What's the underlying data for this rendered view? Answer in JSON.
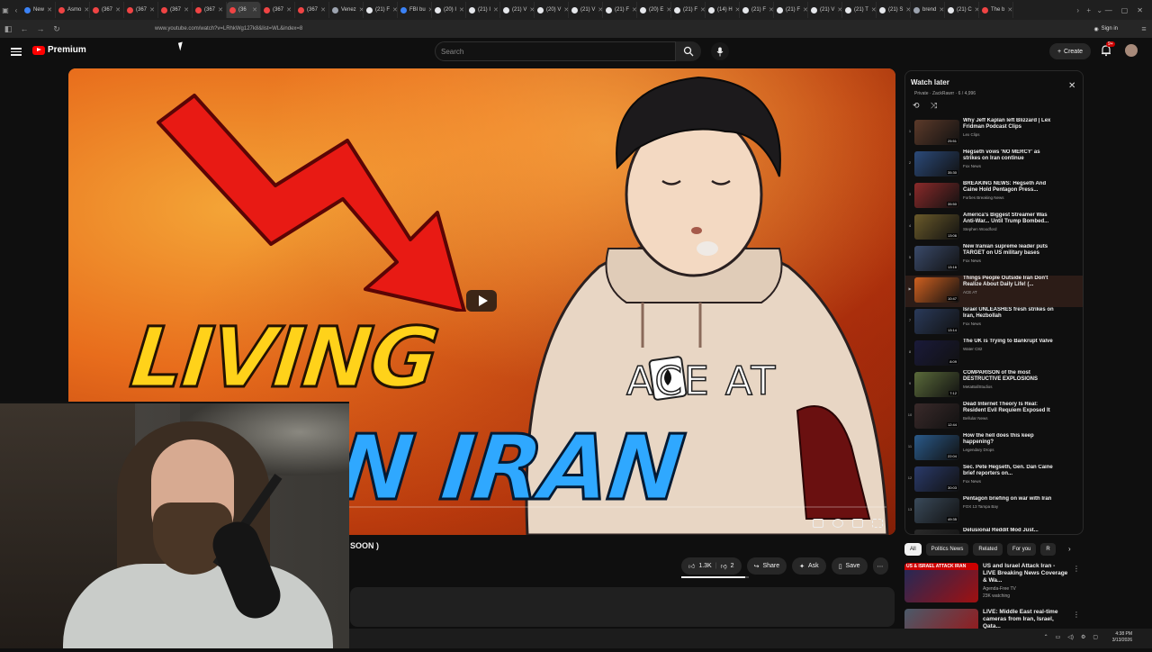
{
  "browser": {
    "tabs": [
      {
        "label": "New",
        "color": "#3b82f6"
      },
      {
        "label": "Asmo",
        "color": "#ef4444"
      },
      {
        "label": "(367",
        "color": "#ef4444"
      },
      {
        "label": "(367",
        "color": "#ef4444"
      },
      {
        "label": "(367",
        "color": "#ef4444"
      },
      {
        "label": "(367",
        "color": "#ef4444"
      },
      {
        "label": "(36",
        "color": "#ef4444",
        "active": true
      },
      {
        "label": "(367",
        "color": "#ef4444"
      },
      {
        "label": "(367",
        "color": "#ef4444"
      },
      {
        "label": "Venez",
        "color": "#9ca3af"
      },
      {
        "label": "(21) F",
        "color": "#e5e7eb"
      },
      {
        "label": "FBI bu",
        "color": "#3b82f6"
      },
      {
        "label": "(20) I",
        "color": "#e5e7eb"
      },
      {
        "label": "(21) I",
        "color": "#e5e7eb"
      },
      {
        "label": "(21) V",
        "color": "#e5e7eb"
      },
      {
        "label": "(20) V",
        "color": "#e5e7eb"
      },
      {
        "label": "(21) V",
        "color": "#e5e7eb"
      },
      {
        "label": "(21) F",
        "color": "#e5e7eb"
      },
      {
        "label": "(20) E",
        "color": "#e5e7eb"
      },
      {
        "label": "(21) F",
        "color": "#e5e7eb"
      },
      {
        "label": "(14) H",
        "color": "#e5e7eb"
      },
      {
        "label": "(21) F",
        "color": "#e5e7eb"
      },
      {
        "label": "(21) F",
        "color": "#e5e7eb"
      },
      {
        "label": "(21) V",
        "color": "#e5e7eb"
      },
      {
        "label": "(21) T",
        "color": "#e5e7eb"
      },
      {
        "label": "(21) S",
        "color": "#e5e7eb"
      },
      {
        "label": "brend",
        "color": "#9ca3af"
      },
      {
        "label": "(21) C",
        "color": "#e5e7eb"
      },
      {
        "label": "The b",
        "color": "#ef4444"
      }
    ],
    "url": "www.youtube.com/watch?v=LRhkWg127k8&list=WL&index=8",
    "sign_in": "Sign in"
  },
  "youtube": {
    "logo_label": "Premium",
    "search_placeholder": "Search",
    "create_label": "Create",
    "notification_count": "9+"
  },
  "video": {
    "thumb_line1": "LIVING",
    "thumb_line2": "N IRAN",
    "thumb_ace": "ACE AT",
    "title_visible": "SOON )",
    "likes": "1.3K",
    "dislikes": "2",
    "share_label": "Share",
    "ask_label": "Ask",
    "save_label": "Save",
    "like_ratio": 0.95
  },
  "playlist": {
    "title": "Watch later",
    "subtitle": "Private · ZackRawrr · 6 / 4,996",
    "items": [
      {
        "idx": "1",
        "title": "Why Jeff Kaplan left Blizzard | Lex Fridman Podcast Clips",
        "channel": "Lex Clips",
        "duration": "25:51",
        "color": "#5c3a2a"
      },
      {
        "idx": "2",
        "title": "Hegseth vows 'NO MERCY' as strikes on Iran continue",
        "channel": "Fox News",
        "duration": "35:30",
        "color": "#2b4a7a"
      },
      {
        "idx": "3",
        "title": "BREAKING NEWS: Hegseth And Caine Hold Pentagon Press...",
        "channel": "Forbes Breaking News",
        "duration": "35:50",
        "color": "#8a2a2a"
      },
      {
        "idx": "4",
        "title": "America's Biggest Streamer Was Anti-War... Until Trump Bombed...",
        "channel": "Stephen Woodford",
        "duration": "13:06",
        "color": "#6a5a2a"
      },
      {
        "idx": "5",
        "title": "New Iranian supreme leader puts TARGET on US military bases",
        "channel": "Fox News",
        "duration": "13:16",
        "color": "#3a4a6a"
      },
      {
        "idx": "▶",
        "title": "Things People Outside Iran Don't Realize About Daily Life! (...",
        "channel": "ACE AT",
        "duration": "10:47",
        "color": "#d06020",
        "current": true
      },
      {
        "idx": "7",
        "title": "Israel UNLEASHES fresh strikes on Iran, Hezbollah",
        "channel": "Fox News",
        "duration": "13:14",
        "color": "#2a3a5a"
      },
      {
        "idx": "8",
        "title": "The UK is Trying to Bankrupt Valve",
        "channel": "Water C82",
        "duration": "8:09",
        "color": "#1a1a3a"
      },
      {
        "idx": "9",
        "title": "COMPARISON of the most DESTRUCTIVE EXPLOSIONS",
        "channel": "MetaBallStudios",
        "duration": "7:12",
        "color": "#5a6a3a"
      },
      {
        "idx": "10",
        "title": "Dead Internet Theory Is Real: Resident Evil Requiem Exposed It",
        "channel": "Bellular News",
        "duration": "12:44",
        "color": "#3a2a2a"
      },
      {
        "idx": "11",
        "title": "How the hell does this keep happening?",
        "channel": "Legendary Drops",
        "duration": "22:04",
        "color": "#2a5a8a"
      },
      {
        "idx": "12",
        "title": "Sec. Pete Hegseth, Gen. Dan Caine brief reporters on...",
        "channel": "Fox News",
        "duration": "30:03",
        "color": "#2a3a6a"
      },
      {
        "idx": "13",
        "title": "Pentagon briefing on war with Iran",
        "channel": "FOX 13 Tampa Bay",
        "duration": "49:35",
        "color": "#3a4a5a"
      },
      {
        "idx": "14",
        "title": "Delusional Reddit Mod Just...",
        "channel": "",
        "duration": "",
        "color": "#2a2a2a"
      }
    ]
  },
  "chips": [
    "All",
    "Politics News",
    "Related",
    "For you",
    "R"
  ],
  "recommendations": [
    {
      "title": "US and Israel Attack Iran - LIVE Breaking News Coverage & Wa...",
      "channel": "Agenda-Free TV",
      "meta": "23K watching",
      "thumb_label": "US & ISRAEL ATTACK IRAN",
      "color": "#1e2a5a"
    },
    {
      "title": "LIVE: Middle East real-time cameras from Iran, Israel, Qata...",
      "channel": "",
      "meta": "",
      "thumb_label": "",
      "color": "#4a5a6a"
    }
  ],
  "taskbar": {
    "time": "4:38 PM",
    "date": "3/13/2026"
  }
}
